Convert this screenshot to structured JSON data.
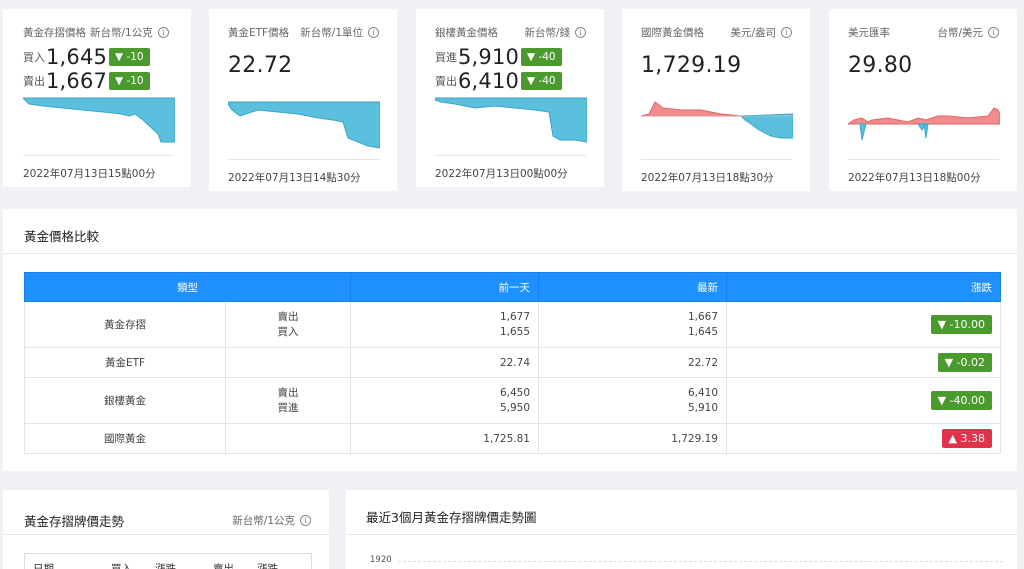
{
  "cards": [
    {
      "title": "黃金存摺價格",
      "unit": "新台幣/1公克",
      "buy_label": "買入",
      "buy_value": "1,645",
      "buy_change": "▼ -10",
      "sell_label": "賣出",
      "sell_value": "1,667",
      "sell_change": "▼ -10",
      "updated": "2022年07月13日15點00分"
    },
    {
      "title": "黃金ETF價格",
      "unit": "新台幣/1單位",
      "value": "22.72",
      "updated": "2022年07月13日14點30分"
    },
    {
      "title": "銀樓黃金價格",
      "unit": "新台幣/錢",
      "buy_label": "買進",
      "buy_value": "5,910",
      "buy_change": "▼ -40",
      "sell_label": "賣出",
      "sell_value": "6,410",
      "sell_change": "▼ -40",
      "updated": "2022年07月13日00點00分"
    },
    {
      "title": "國際黃金價格",
      "unit": "美元/盎司",
      "value": "1,729.19",
      "updated": "2022年07月13日18點30分"
    },
    {
      "title": "美元匯率",
      "unit": "台幣/美元",
      "value": "29.80",
      "updated": "2022年07月13日18點00分"
    }
  ],
  "info_icon": "i",
  "comparison": {
    "title": "黃金價格比較",
    "headers": [
      "類型",
      "前一天",
      "最新",
      "漲跌"
    ],
    "rows": [
      {
        "type": "黃金存摺",
        "sub1": "賣出",
        "sub2": "買入",
        "prev1": "1,677",
        "prev2": "1,655",
        "latest1": "1,667",
        "latest2": "1,645",
        "change": "▼ -10.00",
        "direction": "down"
      },
      {
        "type": "黃金ETF",
        "sub1": "",
        "sub2": "",
        "prev1": "22.74",
        "prev2": "",
        "latest1": "22.72",
        "latest2": "",
        "change": "▼ -0.02",
        "direction": "down"
      },
      {
        "type": "銀樓黃金",
        "sub1": "賣出",
        "sub2": "買進",
        "prev1": "6,450",
        "prev2": "5,950",
        "latest1": "6,410",
        "latest2": "5,910",
        "change": "▼ -40.00",
        "direction": "down"
      },
      {
        "type": "國際黃金",
        "sub1": "",
        "sub2": "",
        "prev1": "1,725.81",
        "prev2": "",
        "latest1": "1,729.19",
        "latest2": "",
        "change": "▲ 3.38",
        "direction": "up"
      }
    ]
  },
  "trend": {
    "title": "黃金存摺牌價走勢",
    "unit": "新台幣/1公克",
    "columns": [
      "日期",
      "買入",
      "漲跌",
      "賣出",
      "漲跌"
    ]
  },
  "chart3m": {
    "title": "最近3個月黃金存摺牌價走勢圖",
    "y_top_label": "1920"
  },
  "colors": {
    "accent": "#1e90ff",
    "down": "#4a9a2e",
    "up": "#e0334b",
    "spark_fill": "#5bc0de",
    "spark_up_fill": "#f28b8b"
  }
}
